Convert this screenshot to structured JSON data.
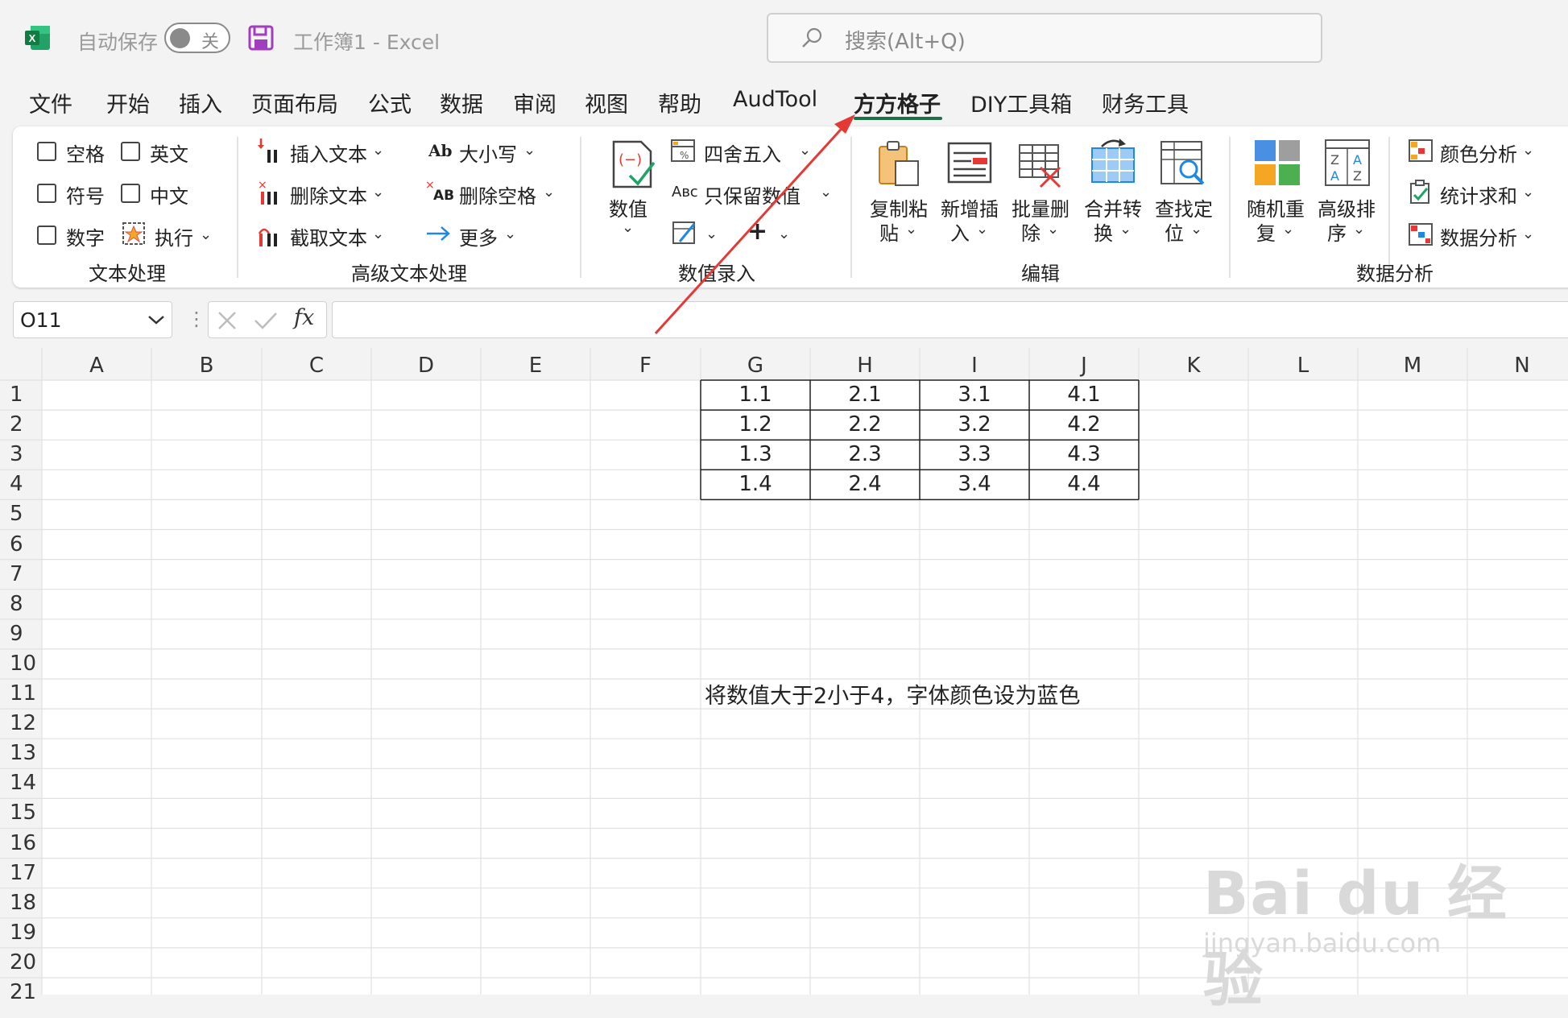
{
  "titlebar": {
    "autosave_label": "自动保存",
    "autosave_state": "关",
    "workbook_title": "工作簿1  -  Excel",
    "search_placeholder": "搜索(Alt+Q)"
  },
  "menu": {
    "tabs": [
      "文件",
      "开始",
      "插入",
      "页面布局",
      "公式",
      "数据",
      "审阅",
      "视图",
      "帮助",
      "AudTool",
      "方方格子",
      "DIY工具箱",
      "财务工具"
    ],
    "active_tab": "方方格子"
  },
  "ribbon": {
    "text_processing": {
      "checkboxes": [
        "空格",
        "英文",
        "符号",
        "中文",
        "数字"
      ],
      "execute": "执行",
      "group_label": "文本处理"
    },
    "advanced_text": {
      "insert_text": "插入文本",
      "delete_text": "删除文本",
      "extract_text": "截取文本",
      "case": "大小写",
      "delete_spaces": "删除空格",
      "more": "更多",
      "group_label": "高级文本处理"
    },
    "numeric_input": {
      "value_button": "数值",
      "round": "四舍五入",
      "keep_values": "只保留数值",
      "group_label": "数值录入"
    },
    "edit": {
      "copy_paste": [
        "复制粘",
        "贴"
      ],
      "insert_new": [
        "新增插",
        "入"
      ],
      "batch_delete": [
        "批量删",
        "除"
      ],
      "merge_convert": [
        "合并转",
        "换"
      ],
      "find_locate": [
        "查找定",
        "位"
      ],
      "group_label": "编辑"
    },
    "data_analysis": {
      "random_repeat": [
        "随机重",
        "复"
      ],
      "advanced_sort": [
        "高级排",
        "序"
      ],
      "color_analysis": "颜色分析",
      "stat_sum": "统计求和",
      "data_analysis": "数据分析",
      "group_label": "数据分析"
    }
  },
  "formula_bar": {
    "name_box": "O11",
    "fx": "fx",
    "formula": ""
  },
  "sheet": {
    "columns": [
      "A",
      "B",
      "C",
      "D",
      "E",
      "F",
      "G",
      "H",
      "I",
      "J",
      "K",
      "L",
      "M",
      "N"
    ],
    "rows": [
      "1",
      "2",
      "3",
      "4",
      "5",
      "6",
      "7",
      "8",
      "9",
      "10",
      "11",
      "12",
      "13",
      "14",
      "15",
      "16",
      "17",
      "18",
      "19",
      "20",
      "21"
    ],
    "table": [
      [
        "1.1",
        "2.1",
        "3.1",
        "4.1"
      ],
      [
        "1.2",
        "2.2",
        "3.2",
        "4.2"
      ],
      [
        "1.3",
        "2.3",
        "3.3",
        "4.3"
      ],
      [
        "1.4",
        "2.4",
        "3.4",
        "4.4"
      ]
    ],
    "note": "将数值大于2小于4，字体颜色设为蓝色"
  },
  "watermark": {
    "brand": "Bai du 经验",
    "url": "jingyan.baidu.com"
  },
  "colors": {
    "excel_green": "#1e7145",
    "arrow_red": "#e53935",
    "gridline": "#e1e1e1"
  }
}
